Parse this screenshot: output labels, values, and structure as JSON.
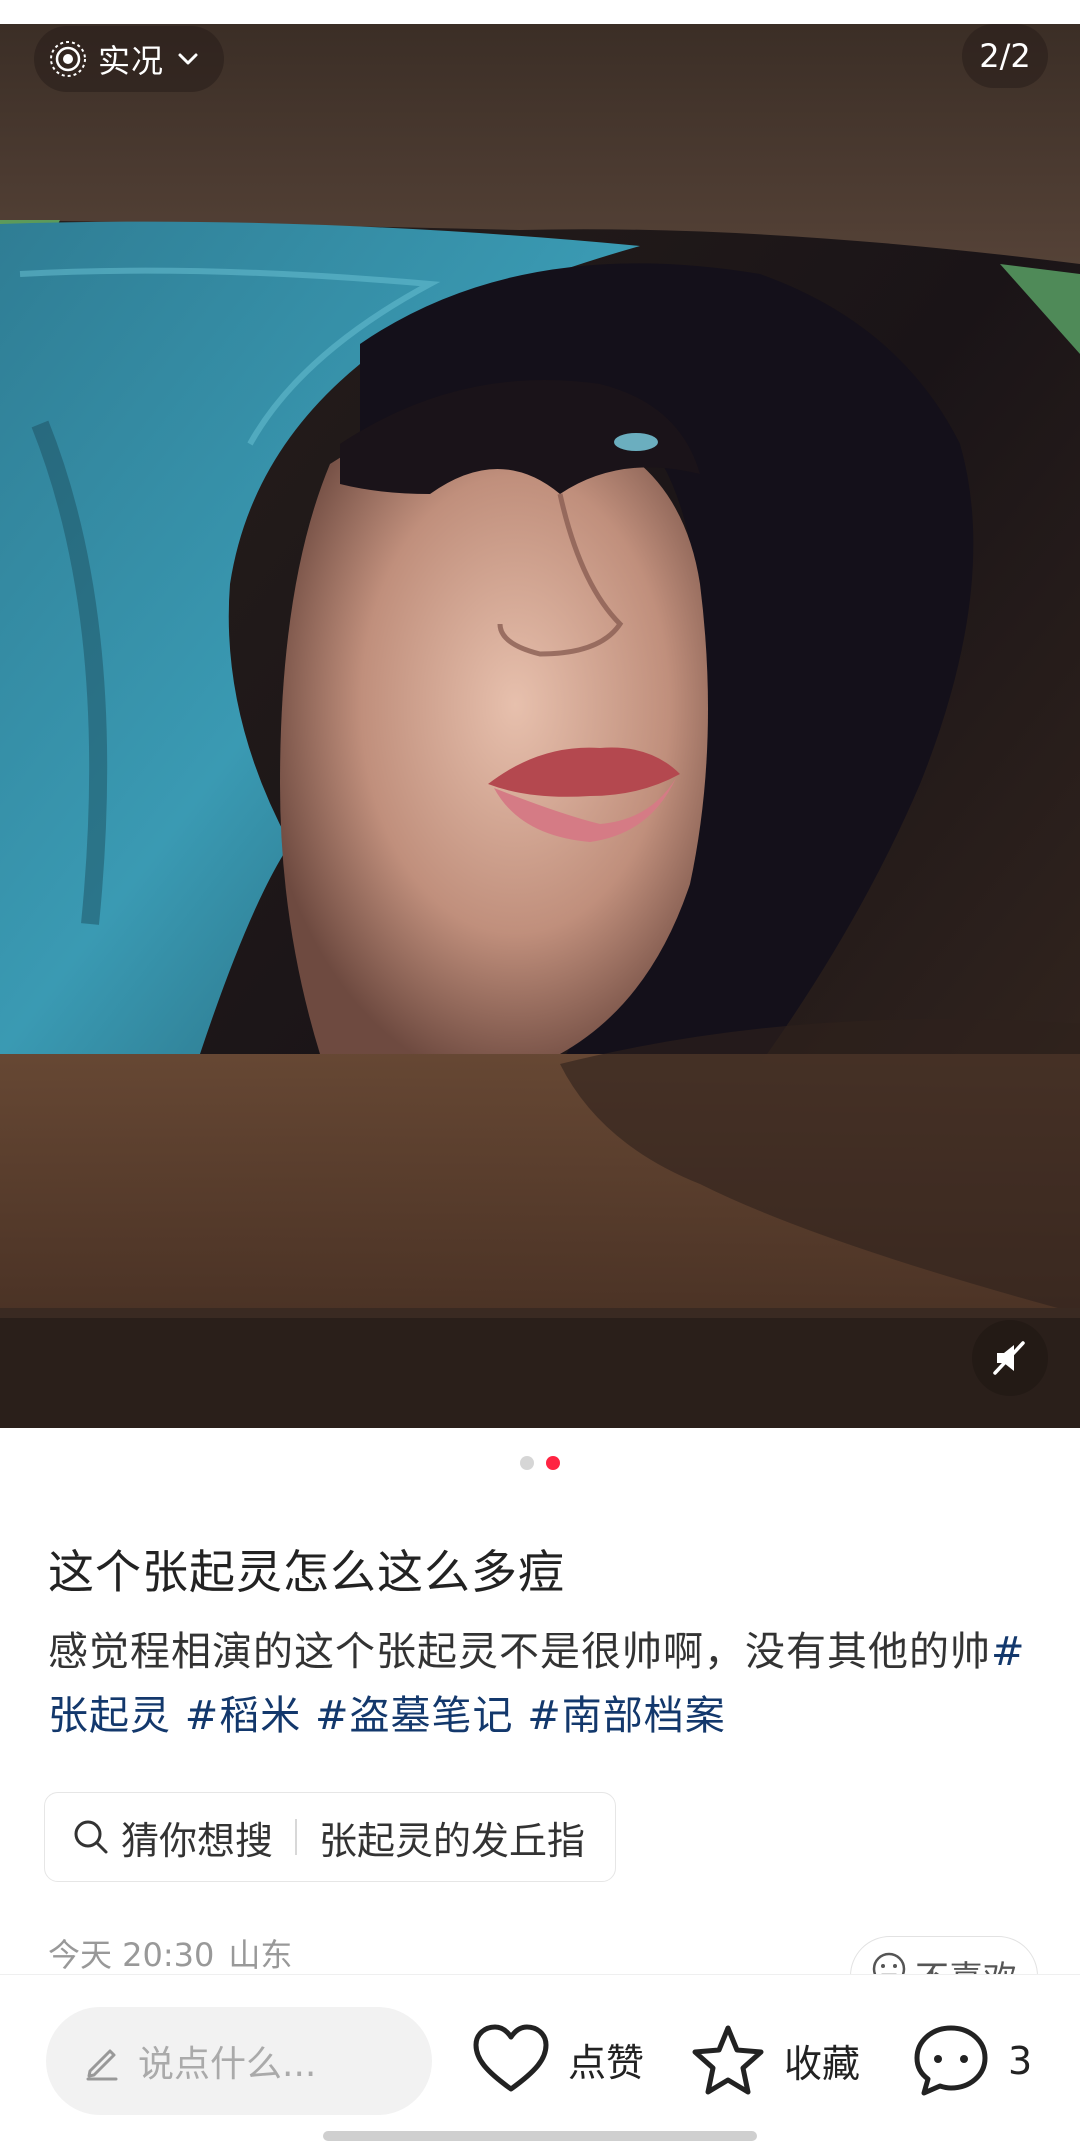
{
  "media": {
    "live_label": "实况",
    "page_indicator": "2/2",
    "carousel_index": 2,
    "carousel_total": 2
  },
  "post": {
    "title": "这个张起灵怎么这么多痘",
    "body_text": "感觉程相演的这个张起灵不是很帅啊，没有其他的帅",
    "tags": [
      "#张起灵",
      "#稻米",
      "#盗墓笔记",
      "#南部档案"
    ]
  },
  "guess_search": {
    "label": "猜你想搜",
    "query": "张起灵的发丘指"
  },
  "meta": {
    "time": "今天 20:30",
    "location": "山东",
    "dislike_label": "不喜欢"
  },
  "bottom_bar": {
    "comment_placeholder": "说点什么...",
    "like_label": "点赞",
    "favorite_label": "收藏",
    "comment_count": "3"
  },
  "colors": {
    "accent": "#ff2442",
    "tag_link": "#13386c",
    "hat_teal": "#3a8fa6"
  },
  "icons": [
    "live-photo-icon",
    "chevron-down-icon",
    "mute-speaker-icon",
    "search-icon",
    "neutral-face-icon",
    "pencil-icon",
    "heart-icon",
    "star-icon",
    "comment-bubble-icon"
  ]
}
